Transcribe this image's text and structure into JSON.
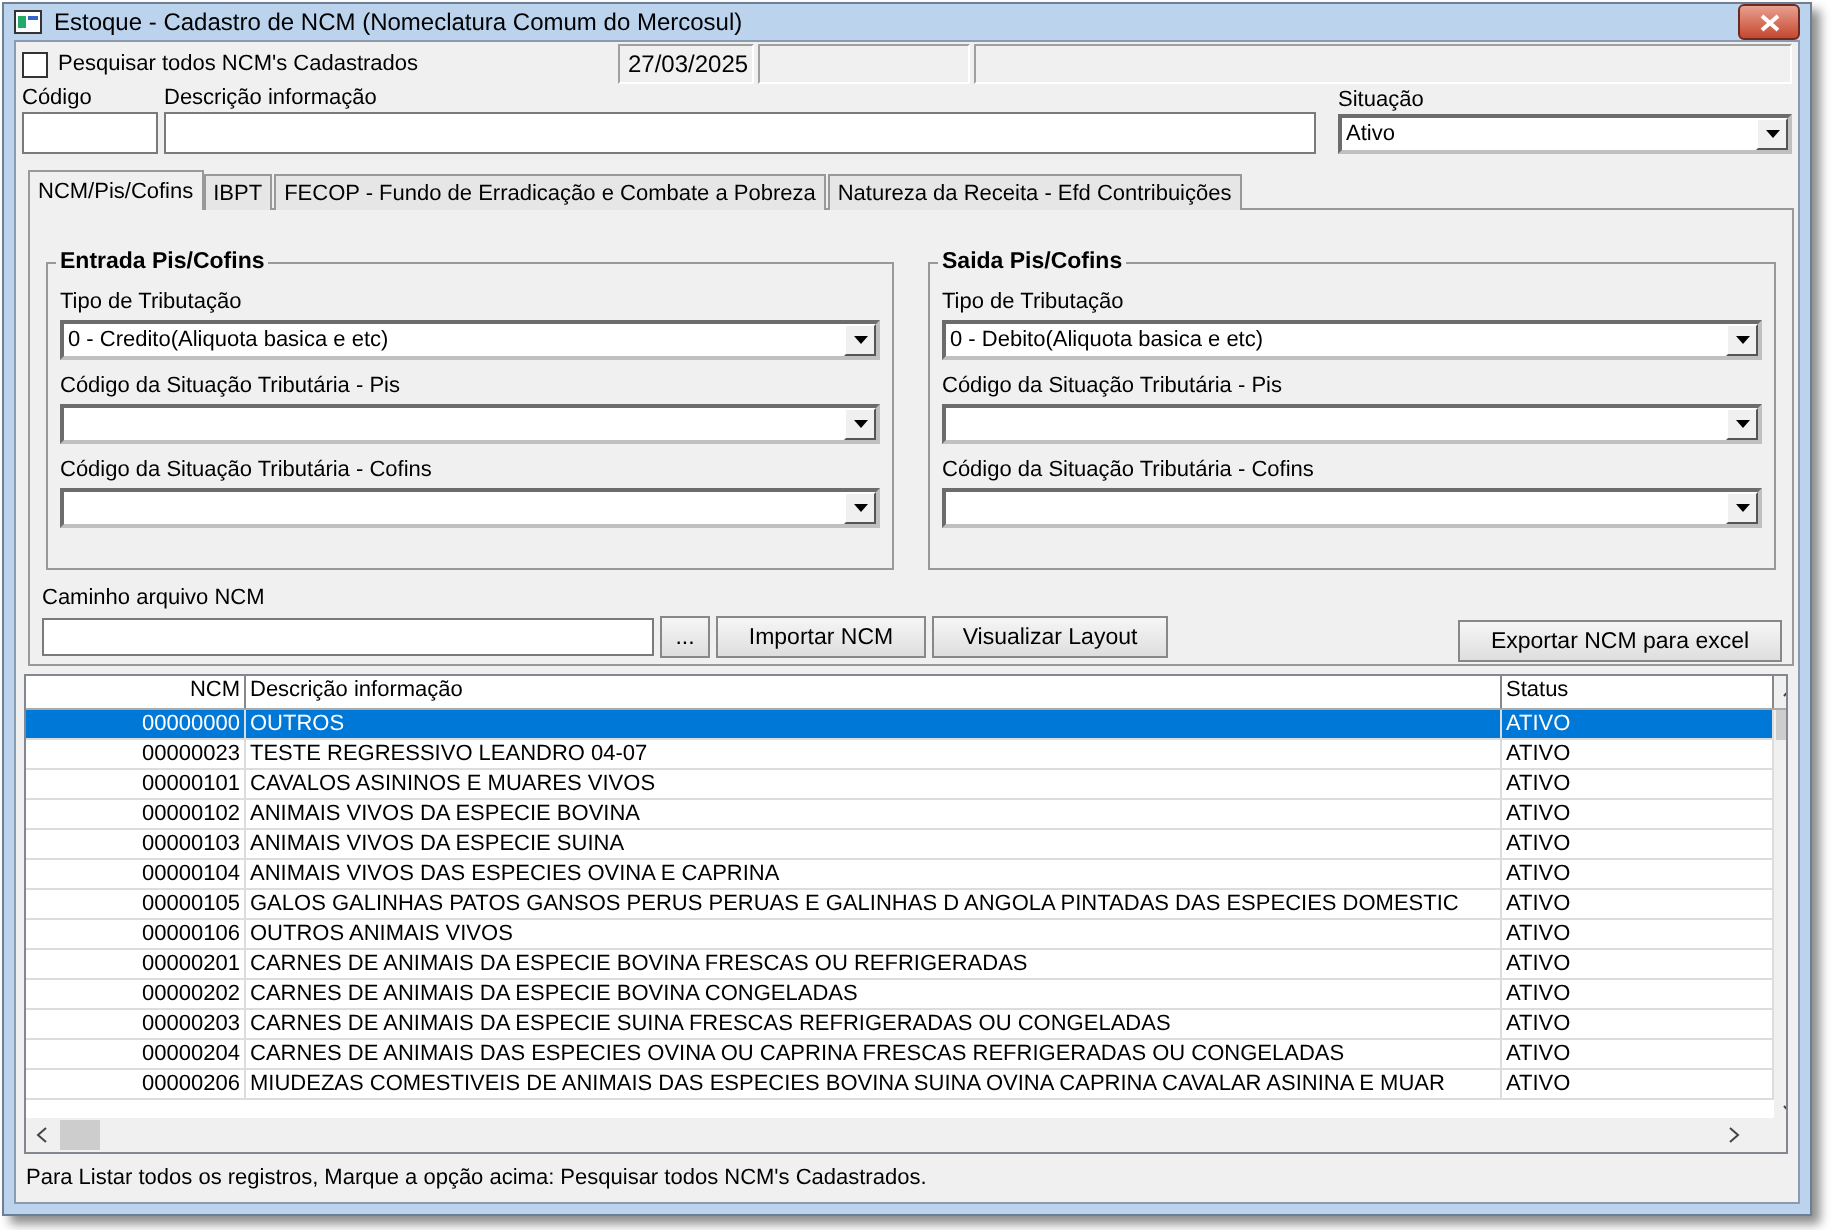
{
  "window": {
    "title": "Estoque - Cadastro de NCM (Nomeclatura Comum do Mercosul)"
  },
  "search_all": {
    "label": "Pesquisar todos NCM's Cadastrados",
    "checked": false
  },
  "date": "27/03/2025",
  "fields": {
    "codigo_label": "Código",
    "descricao_label": "Descrição informação",
    "situacao_label": "Situação",
    "situacao_value": "Ativo"
  },
  "tabs": [
    {
      "label": "NCM/Pis/Cofins",
      "selected": true
    },
    {
      "label": "IBPT",
      "selected": false
    },
    {
      "label": "FECOP - Fundo de Erradicação e Combate a Pobreza",
      "selected": false
    },
    {
      "label": "Natureza da Receita - Efd Contribuições",
      "selected": false
    }
  ],
  "groups": [
    {
      "title": "Entrada Pis/Cofins",
      "selects": [
        {
          "label": "Tipo de Tributação",
          "value": "0 - Credito(Aliquota basica e etc)"
        },
        {
          "label": "Código da Situação Tributária - Pis"
        },
        {
          "label": "Código da Situação Tributária - Cofins"
        }
      ]
    },
    {
      "title": "Saida Pis/Cofins",
      "selects": [
        {
          "label": "Tipo de Tributação",
          "value": "0 - Debito(Aliquota basica e etc)"
        },
        {
          "label": "Código da Situação Tributária - Pis"
        },
        {
          "label": "Código da Situação Tributária - Cofins"
        }
      ]
    }
  ],
  "file": {
    "label": "Caminho arquivo NCM",
    "browse": "...",
    "import": "Importar NCM",
    "layout": "Visualizar Layout",
    "export": "Exportar NCM para excel"
  },
  "table": {
    "columns": [
      "NCM",
      "Descrição informação",
      "Status"
    ],
    "rows": [
      {
        "ncm": "00000000",
        "desc": "OUTROS",
        "status": "ATIVO",
        "selected": true
      },
      {
        "ncm": "00000023",
        "desc": "TESTE REGRESSIVO LEANDRO 04-07",
        "status": "ATIVO",
        "selected": false
      },
      {
        "ncm": "00000101",
        "desc": "CAVALOS  ASININOS E MUARES  VIVOS",
        "status": "ATIVO",
        "selected": false
      },
      {
        "ncm": "00000102",
        "desc": "ANIMAIS VIVOS DA ESPECIE BOVINA",
        "status": "ATIVO",
        "selected": false
      },
      {
        "ncm": "00000103",
        "desc": "ANIMAIS VIVOS DA ESPECIE SUINA",
        "status": "ATIVO",
        "selected": false
      },
      {
        "ncm": "00000104",
        "desc": "ANIMAIS VIVOS DAS ESPECIES OVINA E CAPRINA",
        "status": "ATIVO",
        "selected": false
      },
      {
        "ncm": "00000105",
        "desc": "GALOS  GALINHAS  PATOS  GANSOS  PERUS  PERUAS E GALINHAS D ANGOLA  PINTADAS   DAS ESPECIES DOMESTIC",
        "status": "ATIVO",
        "selected": false
      },
      {
        "ncm": "00000106",
        "desc": "OUTROS ANIMAIS VIVOS",
        "status": "ATIVO",
        "selected": false
      },
      {
        "ncm": "00000201",
        "desc": "CARNES DE ANIMAIS DA ESPECIE BOVINA  FRESCAS OU REFRIGERADAS",
        "status": "ATIVO",
        "selected": false
      },
      {
        "ncm": "00000202",
        "desc": "CARNES DE ANIMAIS DA ESPECIE BOVINA  CONGELADAS",
        "status": "ATIVO",
        "selected": false
      },
      {
        "ncm": "00000203",
        "desc": "CARNES DE ANIMAIS DA ESPECIE SUINA  FRESCAS  REFRIGERADAS OU CONGELADAS",
        "status": "ATIVO",
        "selected": false
      },
      {
        "ncm": "00000204",
        "desc": "CARNES DE ANIMAIS DAS ESPECIES OVINA OU CAPRINA  FRESCAS  REFRIGERADAS OU CONGELADAS",
        "status": "ATIVO",
        "selected": false
      },
      {
        "ncm": "00000206",
        "desc": "MIUDEZAS COMESTIVEIS DE ANIMAIS DAS ESPECIES BOVINA  SUINA  OVINA  CAPRINA  CAVALAR  ASININA E MUAR",
        "status": "ATIVO",
        "selected": false
      }
    ]
  },
  "status_bar": "Para Listar todos os registros, Marque a opção acima: Pesquisar todos NCM's Cadastrados."
}
